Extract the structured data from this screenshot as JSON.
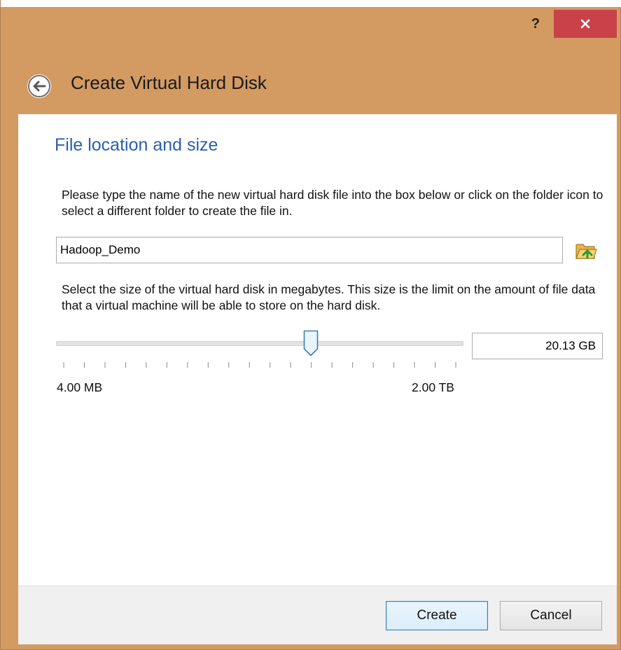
{
  "window": {
    "help_label": "?",
    "title": "Create Virtual Hard Disk"
  },
  "page": {
    "section_title": "File location and size",
    "location_instructions": "Please type the name of the new virtual hard disk file into the box below or click on the folder icon to select a different folder to create the file in.",
    "file_name_value": "Hadoop_Demo",
    "size_instructions": "Select the size of the virtual hard disk in megabytes. This size is the limit on the amount of file data that a virtual machine will be able to store on the hard disk.",
    "size_value": "20.13 GB",
    "slider_min_label": "4.00 MB",
    "slider_max_label": "2.00 TB",
    "slider_fraction": 0.63
  },
  "buttons": {
    "create_label": "Create",
    "cancel_label": "Cancel"
  },
  "icons": {
    "close": "close-icon",
    "back": "back-arrow-icon",
    "folder": "folder-icon"
  },
  "colors": {
    "title_bar": "#d39a62",
    "close_button": "#c9424a",
    "section_title": "#2b5fae",
    "default_button_border": "#3c7fb1"
  }
}
